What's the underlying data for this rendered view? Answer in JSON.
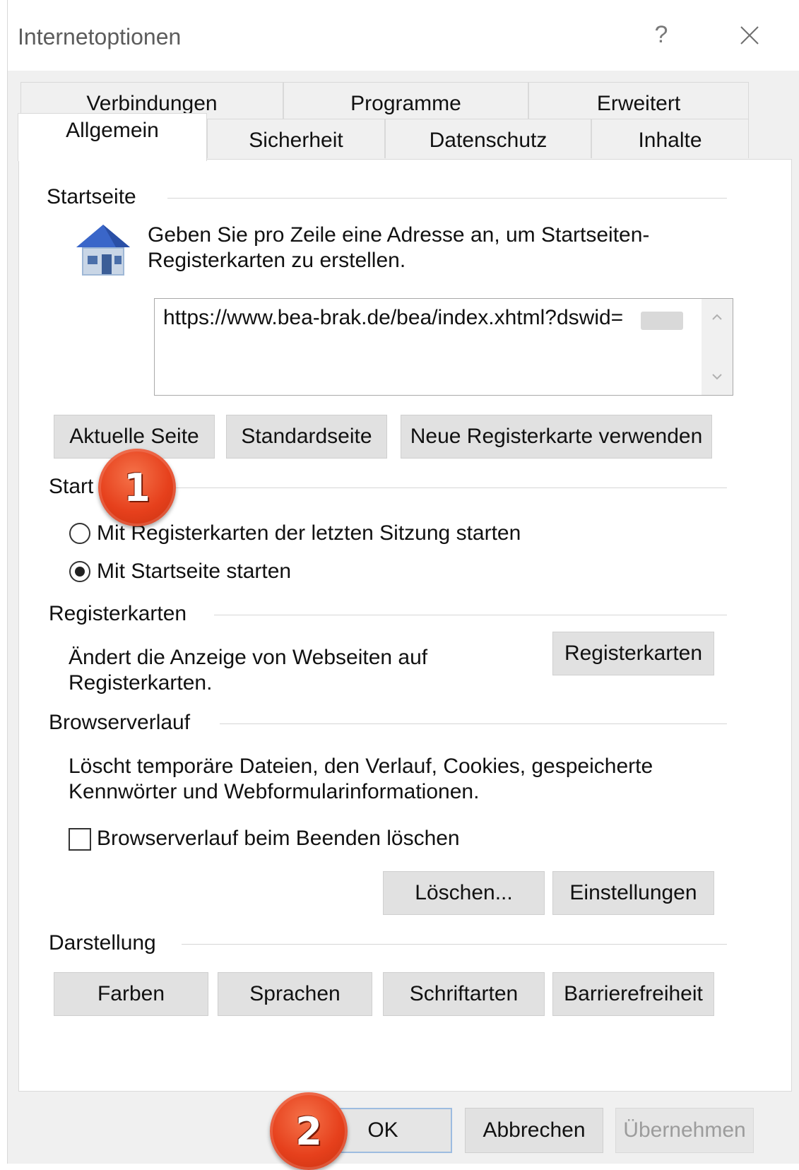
{
  "window": {
    "title": "Internetoptionen",
    "help_label": "?"
  },
  "tabs": {
    "back_row": [
      "Verbindungen",
      "Programme",
      "Erweitert"
    ],
    "front_row": [
      "Allgemein",
      "Sicherheit",
      "Datenschutz",
      "Inhalte"
    ],
    "active": "Allgemein"
  },
  "startseite": {
    "heading": "Startseite",
    "description_line1": "Geben Sie pro Zeile eine Adresse an, um Startseiten-",
    "description_line2": "Registerkarten zu erstellen.",
    "url_value": "https://www.bea-brak.de/bea/index.xhtml?dswid=",
    "buttons": {
      "current": "Aktuelle Seite",
      "default": "Standardseite",
      "new_tab": "Neue Registerkarte verwenden"
    }
  },
  "start": {
    "heading": "Start",
    "options": [
      {
        "label": "Mit Registerkarten der letzten Sitzung starten",
        "selected": false
      },
      {
        "label": "Mit Startseite starten",
        "selected": true
      }
    ]
  },
  "registerkarten": {
    "heading": "Registerkarten",
    "description_line1": "Ändert die Anzeige von Webseiten auf",
    "description_line2": "Registerkarten.",
    "button": "Registerkarten"
  },
  "browserverlauf": {
    "heading": "Browserverlauf",
    "description_line1": "Löscht temporäre Dateien, den Verlauf, Cookies, gespeicherte",
    "description_line2": "Kennwörter und Webformularinformationen.",
    "checkbox_label": "Browserverlauf beim Beenden löschen",
    "checkbox_checked": false,
    "buttons": {
      "delete": "Löschen...",
      "settings": "Einstellungen"
    }
  },
  "darstellung": {
    "heading": "Darstellung",
    "buttons": {
      "colors": "Farben",
      "languages": "Sprachen",
      "fonts": "Schriftarten",
      "accessibility": "Barrierefreiheit"
    }
  },
  "footer": {
    "ok": "OK",
    "cancel": "Abbrechen",
    "apply": "Übernehmen"
  },
  "markers": [
    "1",
    "2"
  ],
  "colors": {
    "marker": "#e6401c",
    "dialog_bg": "#f0f0f0",
    "button_bg": "#e1e1e1"
  }
}
